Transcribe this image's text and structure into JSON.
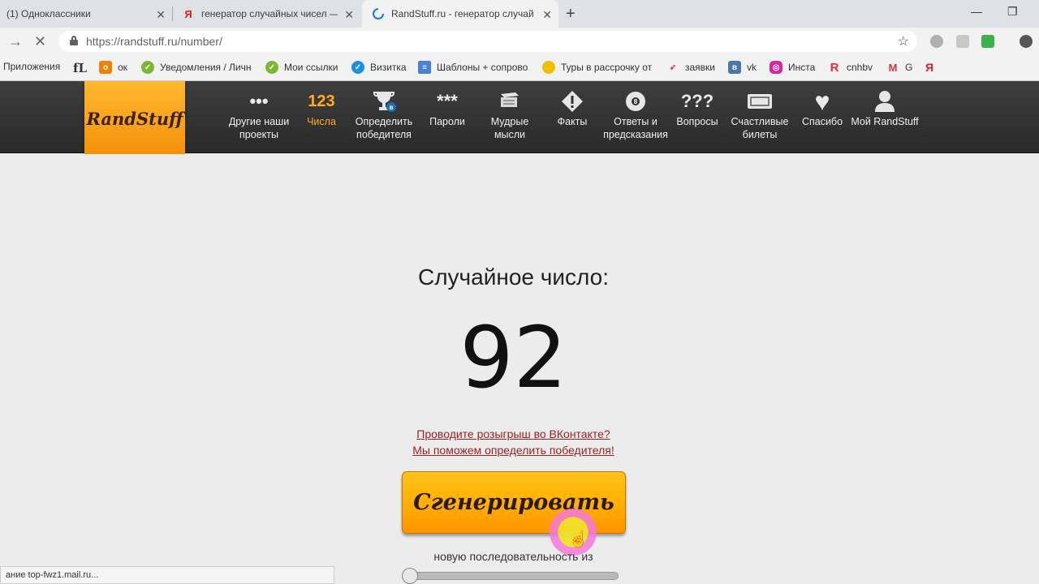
{
  "browser": {
    "tabs": [
      {
        "title": "(1) Одноклассники",
        "favicon": "ok-icon"
      },
      {
        "title": "генератор случайных чисел —",
        "favicon": "yandex-icon"
      },
      {
        "title": "RandStuff.ru - генератор случай",
        "favicon": "loading-icon",
        "active": true
      }
    ],
    "new_tab": "+",
    "url": "https://randstuff.ru/number/",
    "status_text": "ание top-fwz1.mail.ru..."
  },
  "bookmarks": [
    {
      "label": "Приложения",
      "icon": "apps-icon"
    },
    {
      "label": "fL",
      "icon": ""
    },
    {
      "label": "ок",
      "icon": "ok-icon"
    },
    {
      "label": "Уведомления / Личн",
      "icon": "check-icon"
    },
    {
      "label": "Мои ссылки",
      "icon": "check-icon"
    },
    {
      "label": "Визитка",
      "icon": "check-blue-icon"
    },
    {
      "label": "Шаблоны + сопрово",
      "icon": "doc-icon"
    },
    {
      "label": "Туры в рассрочку от",
      "icon": "tour-icon"
    },
    {
      "label": "заявки",
      "icon": "rocket-icon"
    },
    {
      "label": "vk",
      "icon": "vk-icon"
    },
    {
      "label": "Инста",
      "icon": "instagram-icon"
    },
    {
      "label": "cnhbv",
      "icon": "r-icon"
    },
    {
      "label": "G",
      "icon": "gmail-icon"
    },
    {
      "label": "Я",
      "icon": "yandex-icon"
    }
  ],
  "site": {
    "logo": "RandStuff",
    "nav": [
      {
        "label": "Другие наши проекты",
        "icon": "dots-icon",
        "glyph": "•••"
      },
      {
        "label": "Числа",
        "icon": "numbers-icon",
        "glyph": "123",
        "active": true
      },
      {
        "label": "Определить победителя",
        "icon": "trophy-icon",
        "glyph": "🏆"
      },
      {
        "label": "Пароли",
        "icon": "password-icon",
        "glyph": "***"
      },
      {
        "label": "Мудрые мысли",
        "icon": "book-icon",
        "glyph": "▤"
      },
      {
        "label": "Факты",
        "icon": "exclamation-icon",
        "glyph": "◆"
      },
      {
        "label": "Ответы и предсказания",
        "icon": "eight-ball-icon",
        "glyph": "●"
      },
      {
        "label": "Вопросы",
        "icon": "question-icon",
        "glyph": "???"
      },
      {
        "label": "Счастливые билеты",
        "icon": "ticket-icon",
        "glyph": "▭"
      },
      {
        "label": "Спасибо",
        "icon": "heart-icon",
        "glyph": "♥"
      },
      {
        "label": "Мой RandStuff",
        "icon": "user-icon",
        "glyph": "●"
      }
    ]
  },
  "main": {
    "heading": "Случайное число:",
    "number": "92",
    "vk_line1": "Проводите розыгрыш во ВКонтакте?",
    "vk_line2": "Мы поможем определить победителя!",
    "generate_label": "Сгенерировать",
    "sequence_label": "новую последовательность из"
  },
  "colors": {
    "accent": "#ffae1a",
    "header_bg": "#333333",
    "link": "#9b1f1f"
  }
}
